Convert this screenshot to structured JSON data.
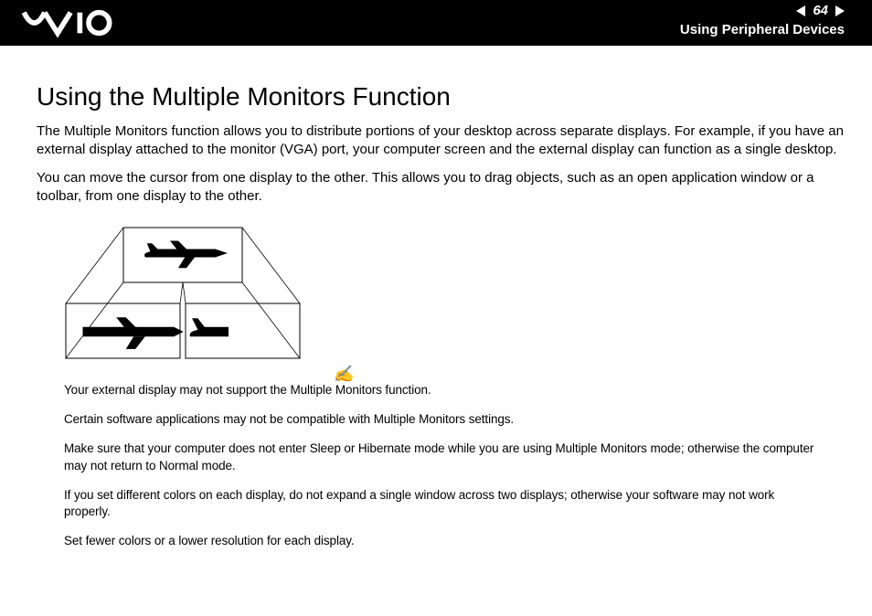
{
  "header": {
    "page_number": "64",
    "section": "Using Peripheral Devices"
  },
  "title": "Using the Multiple Monitors Function",
  "paragraphs": {
    "p1": "The Multiple Monitors function allows you to distribute portions of your desktop across separate displays. For example, if you have an external display attached to the monitor (VGA) port, your computer screen and the external display can function as a single desktop.",
    "p2": "You can move the cursor from one display to the other. This allows you to drag objects, such as an open application window or a toolbar, from one display to the other."
  },
  "notes": {
    "n1": "Your external display may not support the Multiple Monitors function.",
    "n2": "Certain software applications may not be compatible with Multiple Monitors settings.",
    "n3": "Make sure that your computer does not enter Sleep or Hibernate mode while you are using Multiple Monitors mode; otherwise the computer may not return to Normal mode.",
    "n4": "If you set different colors on each display, do not expand a single window across two displays; otherwise your software may not work properly.",
    "n5": "Set fewer colors or a lower resolution for each display."
  }
}
